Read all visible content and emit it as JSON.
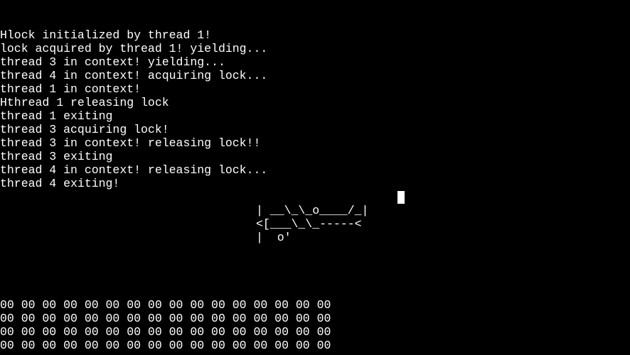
{
  "terminal": {
    "log_lines": [
      "Hlock initialized by thread 1!",
      "lock acquired by thread 1! yielding...",
      "thread 3 in context! yielding...",
      "thread 4 in context! acquiring lock...",
      "thread 1 in context!",
      "Hthread 1 releasing lock",
      "thread 1 exiting",
      "thread 3 acquiring lock!",
      "thread 3 in context! releasing lock!!",
      "thread 3 exiting",
      "thread 4 in context! releasing lock...",
      "thread 4 exiting!"
    ],
    "ascii_art": [
      "| __\\_\\_o____/_|",
      "<[___\\_\\_-----<",
      "|  o'"
    ],
    "hex_rows": [
      "00 00 00 00 00 00 00 00 00 00 00 00 00 00 00 00",
      "00 00 00 00 00 00 00 00 00 00 00 00 00 00 00 00",
      "00 00 00 00 00 00 00 00 00 00 00 00 00 00 00 00",
      "00 00 00 00 00 00 00 00 00 00 00 00 00 00 00 00"
    ]
  },
  "colors": {
    "background": "#000000",
    "foreground": "#ffffff"
  }
}
